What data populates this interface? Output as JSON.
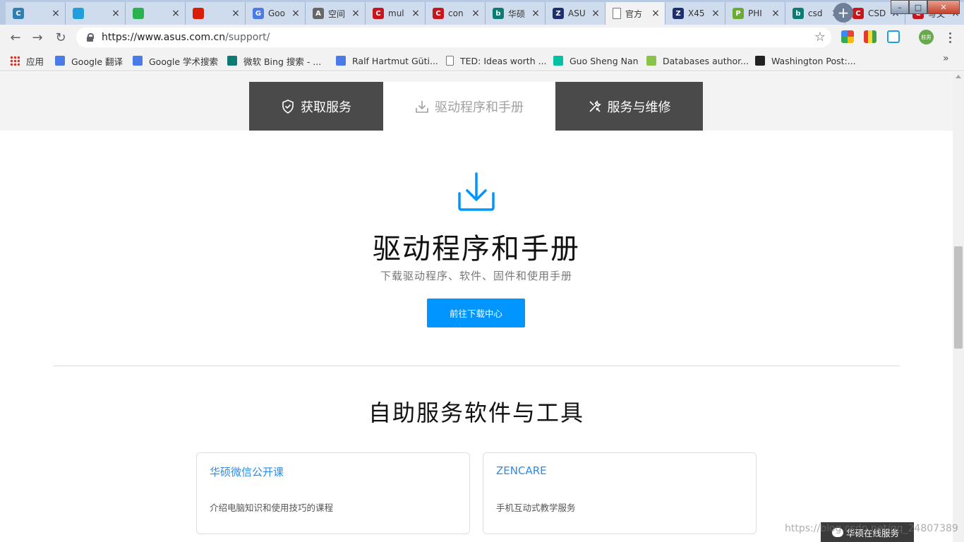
{
  "browser": {
    "tabs": [
      {
        "title": "",
        "favicon": "C",
        "color": "#2f7fb5"
      },
      {
        "title": "",
        "favicon": "tv",
        "color": "#20a0da"
      },
      {
        "title": "",
        "favicon": "wechat",
        "color": "#2ab24f"
      },
      {
        "title": "",
        "favicon": "music",
        "color": "#d81e06"
      },
      {
        "title": "Goo",
        "favicon": "G",
        "color": "#4a7be8"
      },
      {
        "title": "空间",
        "favicon": "A",
        "color": "#666666"
      },
      {
        "title": "mul",
        "favicon": "C",
        "color": "#c8161d"
      },
      {
        "title": "con",
        "favicon": "C",
        "color": "#c8161d"
      },
      {
        "title": "华硕",
        "favicon": "b",
        "color": "#0c7b72"
      },
      {
        "title": "ASU",
        "favicon": "Z",
        "color": "#1d2f6c"
      },
      {
        "title": "官方",
        "favicon": "doc",
        "color": "#ffffff"
      },
      {
        "title": "X45",
        "favicon": "Z",
        "color": "#1d2f6c"
      },
      {
        "title": "PHI",
        "favicon": "P",
        "color": "#6aaa35"
      },
      {
        "title": "csd",
        "favicon": "b",
        "color": "#0c7b72"
      },
      {
        "title": "CSD",
        "favicon": "C",
        "color": "#c8161d"
      },
      {
        "title": "写文",
        "favicon": "C",
        "color": "#c8161d"
      }
    ],
    "close_glyph": "×",
    "new_tab_glyph": "+",
    "url_host": "https://www.asus.com.cn",
    "url_path": "/support/",
    "profile_label": "胜男",
    "bookmarks": [
      {
        "label": "应用",
        "icon": "apps-icon",
        "color": "#e8e8e8"
      },
      {
        "label": "Google 翻译",
        "icon": "google-translate-icon",
        "color": "#4a7be8"
      },
      {
        "label": "Google 学术搜索",
        "icon": "scholar-icon",
        "color": "#4a7be8"
      },
      {
        "label": "微软 Bing 搜索 - ...",
        "icon": "bing-icon",
        "color": "#0c7b72"
      },
      {
        "label": "Ralf Hartmut Güti...",
        "icon": "graduation-icon",
        "color": "#4a7be8"
      },
      {
        "label": "TED: Ideas worth ...",
        "icon": "page-icon",
        "color": "#ffffff"
      },
      {
        "label": "Guo Sheng Nan",
        "icon": "researchgate-icon",
        "color": "#00c1a1"
      },
      {
        "label": "Databases author...",
        "icon": "smiley-icon",
        "color": "#8bc34a"
      },
      {
        "label": "Washington Post:...",
        "icon": "wp-icon",
        "color": "#222222"
      }
    ],
    "bookmarks_more": "»"
  },
  "page": {
    "service_tabs": [
      {
        "label": "获取服务",
        "icon": "shield-icon",
        "active": false
      },
      {
        "label": "驱动程序和手册",
        "icon": "download-icon",
        "active": true
      },
      {
        "label": "服务与维修",
        "icon": "tools-icon",
        "active": false
      }
    ],
    "drivers": {
      "title": "驱动程序和手册",
      "subtitle": "下载驱动程序、软件、固件和使用手册",
      "button": "前往下载中心"
    },
    "tools": {
      "title": "自助服务软件与工具",
      "cards": [
        {
          "title": "华硕微信公开课",
          "desc": "介绍电脑知识和使用技巧的课程"
        },
        {
          "title": "ZENCARE",
          "desc": "手机互动式教学服务"
        }
      ]
    },
    "chat_badge": "华硕在线服务",
    "watermark": "https://blog.csdn.net/qq_24807389"
  },
  "colors": {
    "accent": "#0095ff",
    "link": "#2e8be6",
    "dark_tab": "#4a4a4a"
  }
}
